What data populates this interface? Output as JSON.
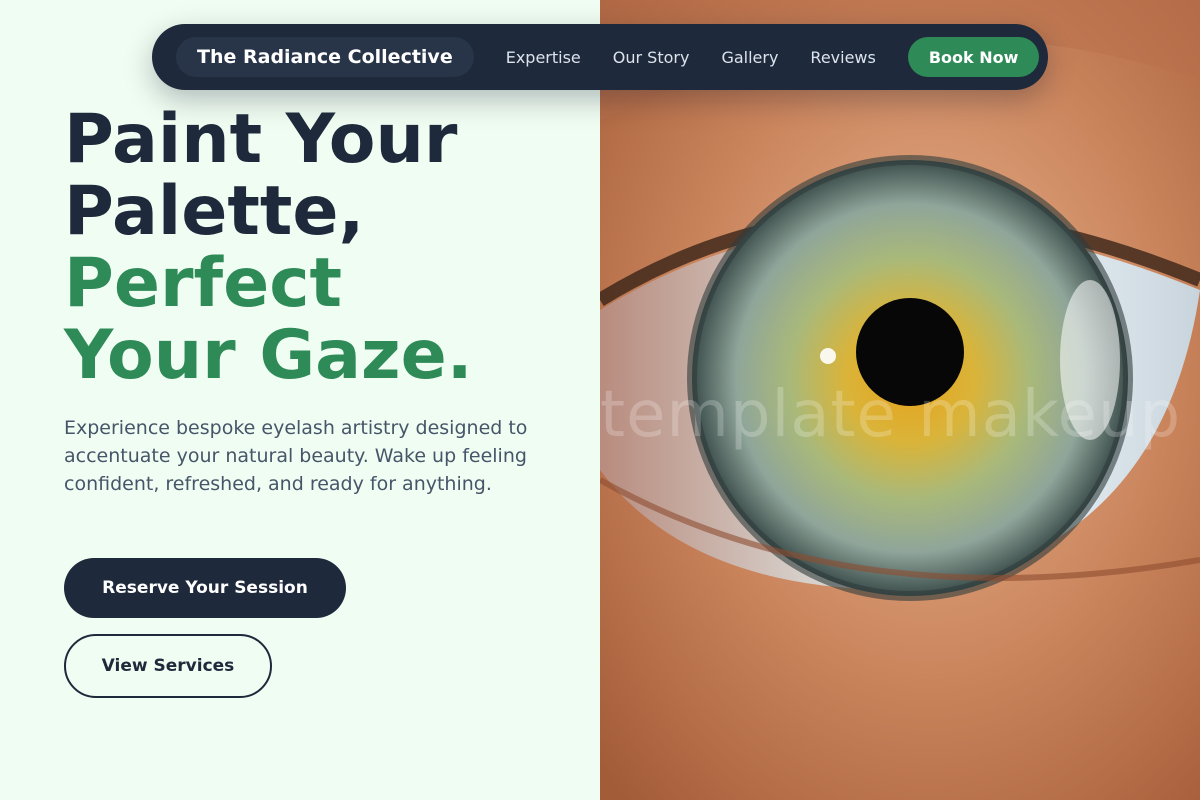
{
  "nav": {
    "brand": "The Radiance Collective",
    "links": [
      "Expertise",
      "Our Story",
      "Gallery",
      "Reviews"
    ],
    "cta": "Book Now"
  },
  "hero": {
    "headline_dark_1": "Paint Your",
    "headline_dark_2": "Palette,",
    "headline_green_1": "Perfect",
    "headline_green_2": "Your Gaze.",
    "lead": "Experience bespoke eyelash artistry designed to accentuate your natural beauty. Wake up feeling confident, refreshed, and ready for anything.",
    "primary_button": "Reserve Your Session",
    "secondary_button": "View Services",
    "image_watermark": "template makeup"
  },
  "colors": {
    "navy": "#1e293b",
    "green": "#2e8b57",
    "background": "#f0fdf2"
  }
}
